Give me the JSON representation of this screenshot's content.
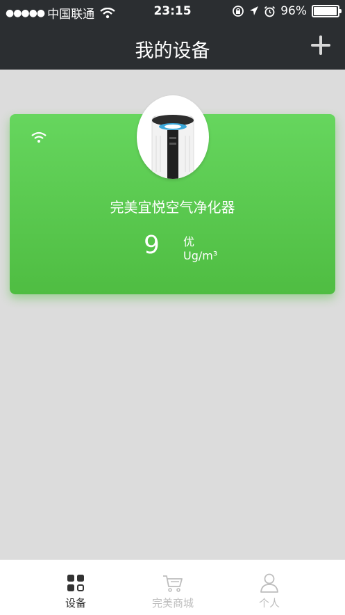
{
  "status": {
    "signal": "●●●●●",
    "carrier": "中国联通",
    "time": "23:15",
    "battery": "96%",
    "battery_level": 0.96
  },
  "header": {
    "title": "我的设备"
  },
  "device": {
    "name": "完美宜悦空气净化器",
    "value": "9",
    "quality": "优",
    "unit": "Ug/m³"
  },
  "tabs": [
    {
      "label": "设备",
      "icon": "grid-icon",
      "active": true
    },
    {
      "label": "完美商城",
      "icon": "cart-icon",
      "active": false
    },
    {
      "label": "个人",
      "icon": "person-icon",
      "active": false
    }
  ],
  "colors": {
    "bar": "#2b2e31",
    "card": "#5fcf55",
    "active": "#333333",
    "inactive": "#bdbdbd"
  }
}
